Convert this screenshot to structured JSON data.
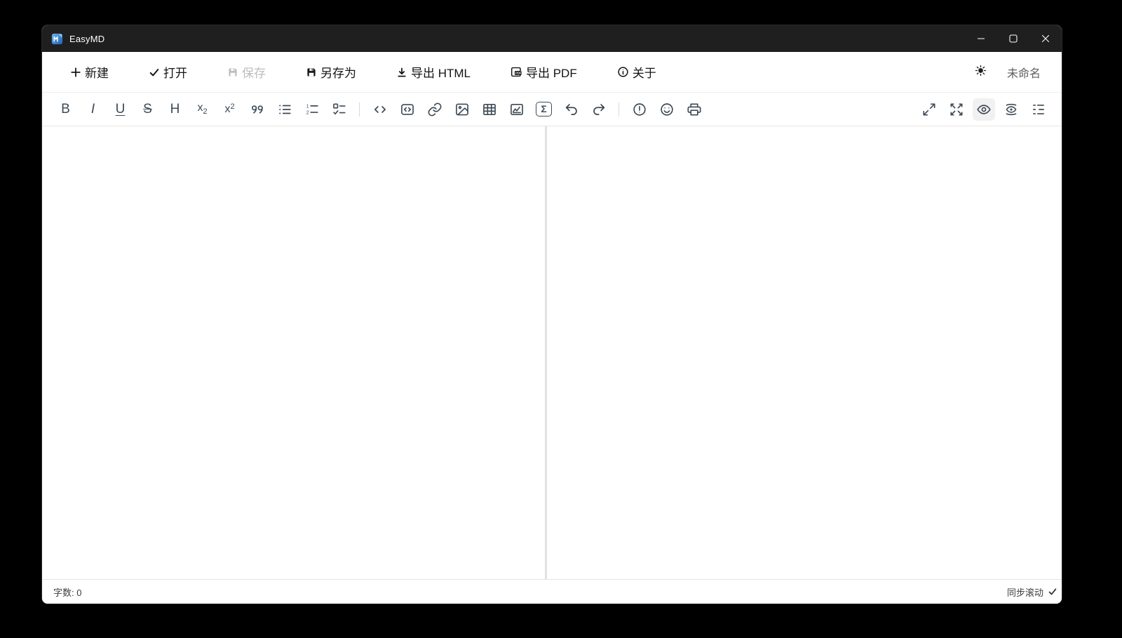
{
  "titlebar": {
    "app_name": "EasyMD"
  },
  "menubar": {
    "new": "新建",
    "open": "打开",
    "save": "保存",
    "save_as": "另存为",
    "export_html": "导出 HTML",
    "export_pdf": "导出 PDF",
    "export_pdf_badge": "PDF",
    "about": "关于",
    "document_name": "未命名",
    "icons": [
      "plus-icon",
      "check-icon",
      "floppy-icon",
      "floppy-icon",
      "download-icon",
      "pdf-file-icon",
      "info-circle-icon",
      "sun-icon"
    ]
  },
  "toolbar": {
    "bold": "B",
    "italic": "I",
    "underline": "U",
    "strikethrough": "S",
    "heading": "H",
    "sub_base": "x",
    "sub_digit": "2",
    "sup_base": "x",
    "sup_digit": "2",
    "ol_num1": "1",
    "ol_num2": "2",
    "formula_symbol": "Σ",
    "left_icons": [
      "bold",
      "italic",
      "underline",
      "strikethrough",
      "heading",
      "subscript",
      "superscript",
      "blockquote",
      "bullet-list",
      "ordered-list",
      "task-list",
      "inline-code",
      "code-block",
      "link",
      "image",
      "table",
      "chart",
      "formula",
      "undo",
      "redo",
      "alert",
      "emoji",
      "print"
    ],
    "right_icons": [
      "shrink",
      "fullscreen",
      "preview-eye",
      "sync-preview-eye",
      "outline"
    ],
    "active_button": "preview-eye"
  },
  "editor": {
    "content": "",
    "preview_content": ""
  },
  "statusbar": {
    "word_count": "字数: 0",
    "sync_scroll": "同步滚动",
    "sync_scroll_checked": true
  },
  "colors": {
    "desktop_bg": "#000000",
    "titlebar_bg": "#1f1f1f",
    "toolbar_icon": "#3e4a56",
    "active_button_bg": "#f1f1f1",
    "app_icon_blue": "#2f7fd4",
    "pane_divider": "#e2e2e2"
  }
}
